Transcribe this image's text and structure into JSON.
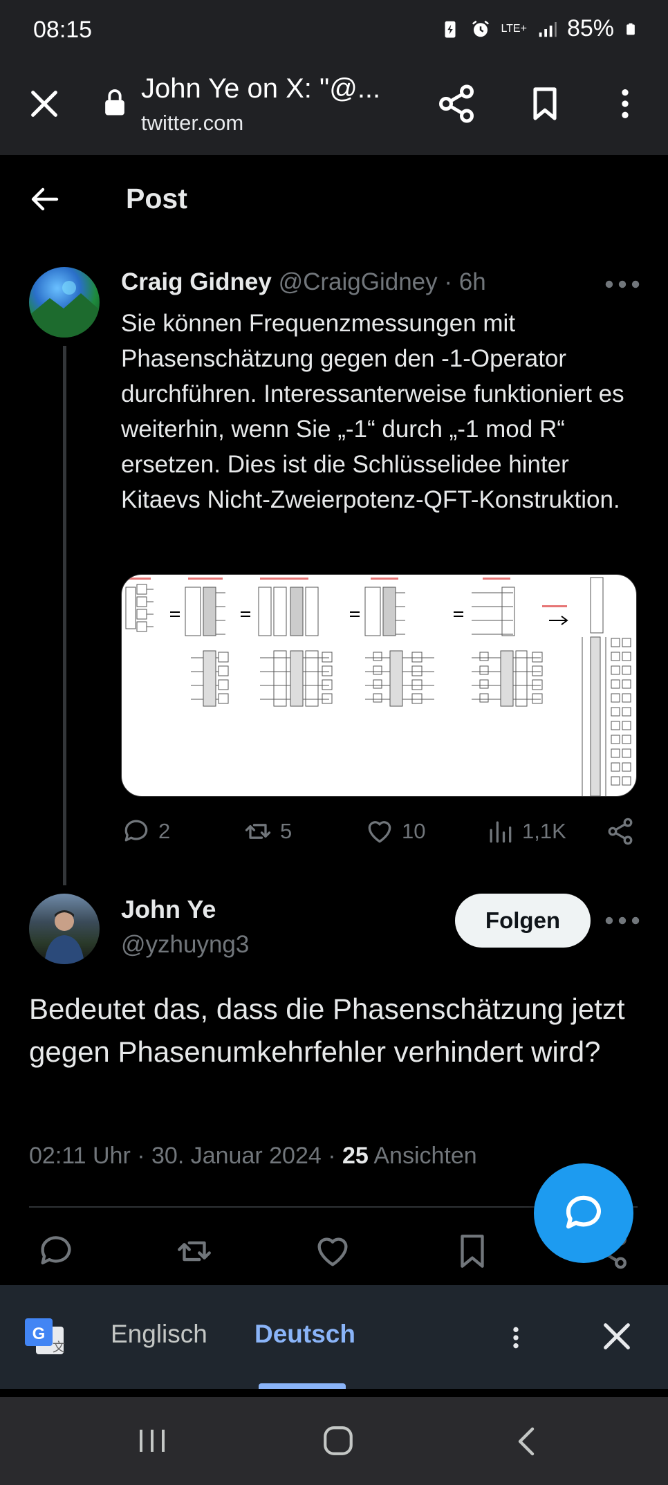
{
  "status_bar": {
    "time": "08:15",
    "network": "LTE+",
    "battery": "85%",
    "icons": [
      "battery-saver-icon",
      "alarm-icon",
      "lte-icon",
      "signal-icon",
      "battery-icon"
    ]
  },
  "browser": {
    "page_title": "John Ye on X: \"@...",
    "url": "twitter.com",
    "icons": [
      "close-icon",
      "lock-icon",
      "share-icon",
      "bookmark-icon",
      "more-vertical-icon"
    ]
  },
  "header": {
    "title": "Post"
  },
  "parent_tweet": {
    "author_name": "Craig Gidney",
    "author_meta": "@CraigGidney · 6h",
    "text": "Sie können Frequenzmessungen mit Phasenschätzung gegen den -1-Operator durchführen. Interessanterweise funktioniert es weiterhin, wenn Sie „-1“ durch „-1 mod R“ ersetzen. Dies ist die Schlüsselidee hinter Kitaevs Nicht-Zweierpotenz-QFT-Konstruktion.",
    "stats": {
      "replies": "2",
      "retweets": "5",
      "likes": "10",
      "views": "1,1K"
    }
  },
  "reply_tweet": {
    "author_name": "John Ye",
    "author_handle": "@yzhuyng3",
    "follow_label": "Folgen",
    "text": "Bedeutet das, dass die Phasenschätzung jetzt gegen Phasenumkehrfehler verhindert wird?",
    "meta_prefix": "02:11 Uhr · 30. Januar 2024 · ",
    "views_count": "25",
    "views_label": " Ansichten"
  },
  "translate_bar": {
    "source_lang": "Englisch",
    "target_lang": "Deutsch"
  },
  "colors": {
    "accent": "#1d9bf0",
    "background": "#000000",
    "muted_text": "#71767b",
    "translate_accent": "#8ab4f8"
  }
}
